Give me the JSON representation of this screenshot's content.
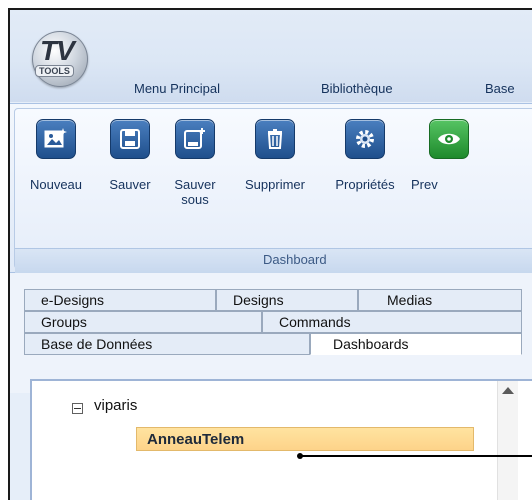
{
  "logo": {
    "main": "TV",
    "sub": "TOOLS"
  },
  "menu": [
    "Menu Principal",
    "Bibliothèque",
    "Base"
  ],
  "ribbon": {
    "buttons": [
      {
        "label": "Nouveau",
        "icon": "image-new-icon"
      },
      {
        "label": "Sauver",
        "icon": "floppy-save-icon"
      },
      {
        "label": "Sauver sous",
        "icon": "floppy-save-as-icon"
      },
      {
        "label": "Supprimer",
        "icon": "trash-icon"
      },
      {
        "label": "Propriétés",
        "icon": "gear-icon"
      },
      {
        "label": "Prev",
        "icon": "eye-icon"
      }
    ],
    "group_label": "Dashboard"
  },
  "tabs": {
    "row1": [
      "e-Designs",
      "Designs",
      "Medias"
    ],
    "row2": [
      "Groups",
      "Commands"
    ],
    "row3": [
      "Base de Données",
      "Dashboards"
    ],
    "active": "Dashboards"
  },
  "tree": {
    "root": "viparis",
    "selected": "AnneauTelem"
  },
  "colors": {
    "accent": "#1f4f8c",
    "selection": "#fdd38a"
  }
}
